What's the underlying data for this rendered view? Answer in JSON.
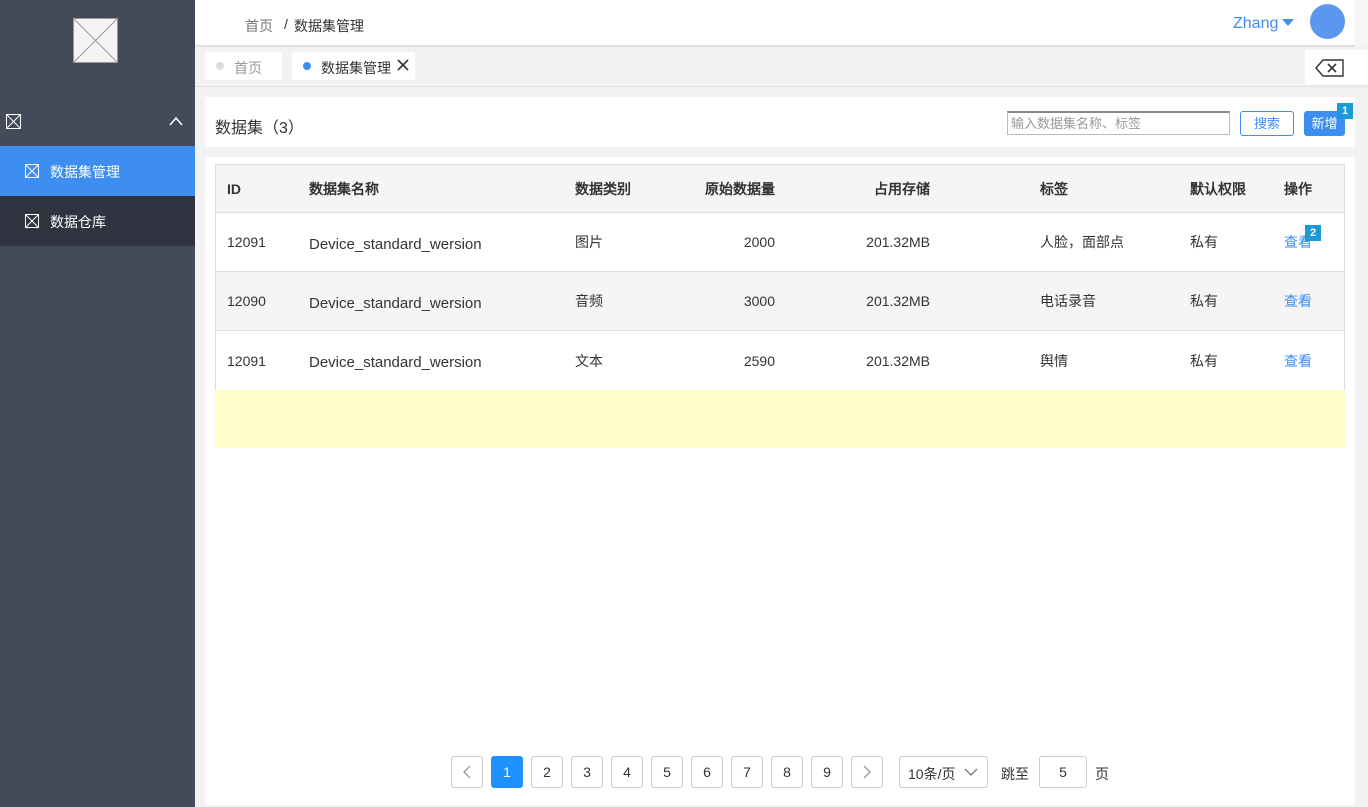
{
  "sidebar": {
    "items": [
      {
        "label": "数据集管理"
      },
      {
        "label": "数据仓库"
      }
    ]
  },
  "header": {
    "breadcrumb_home": "首页",
    "breadcrumb_sep": "/",
    "breadcrumb_current": "数据集管理",
    "user_name": "Zhang"
  },
  "tabs": [
    {
      "label": "首页"
    },
    {
      "label": "数据集管理"
    }
  ],
  "toolbar": {
    "title": "数据集（3）",
    "search_placeholder": "输入数据集名称、标签",
    "search_label": "搜索",
    "add_label": "新增",
    "marker_1": "1"
  },
  "table": {
    "columns": [
      "ID",
      "数据集名称",
      "数据类别",
      "原始数据量",
      "占用存储",
      "标签",
      "默认权限",
      "操作"
    ],
    "rows": [
      {
        "id": "12091",
        "name": "Device_standard_wersion",
        "type": "图片",
        "amount": "2000",
        "storage": "201.32MB",
        "tag": "人脸，面部点",
        "perm": "私有",
        "op": "查看"
      },
      {
        "id": "12090",
        "name": "Device_standard_wersion",
        "type": "音频",
        "amount": "3000",
        "storage": "201.32MB",
        "tag": "电话录音",
        "perm": "私有",
        "op": "查看"
      },
      {
        "id": "12091",
        "name": "Device_standard_wersion",
        "type": "文本",
        "amount": "2590",
        "storage": "201.32MB",
        "tag": "舆情",
        "perm": "私有",
        "op": "查看"
      }
    ],
    "marker_2": "2"
  },
  "pagination": {
    "pages": [
      "1",
      "2",
      "3",
      "4",
      "5",
      "6",
      "7",
      "8",
      "9"
    ],
    "current": "1",
    "page_size": "10条/页",
    "goto_label": "跳至",
    "goto_value": "5",
    "goto_unit": "页"
  },
  "colors": {
    "accent": "#3d8ef0",
    "sidebar_bg": "#434a5a",
    "sidebar_dark": "#2f3440",
    "highlight_band": "#ffffcc",
    "marker": "#1a9ad6"
  }
}
